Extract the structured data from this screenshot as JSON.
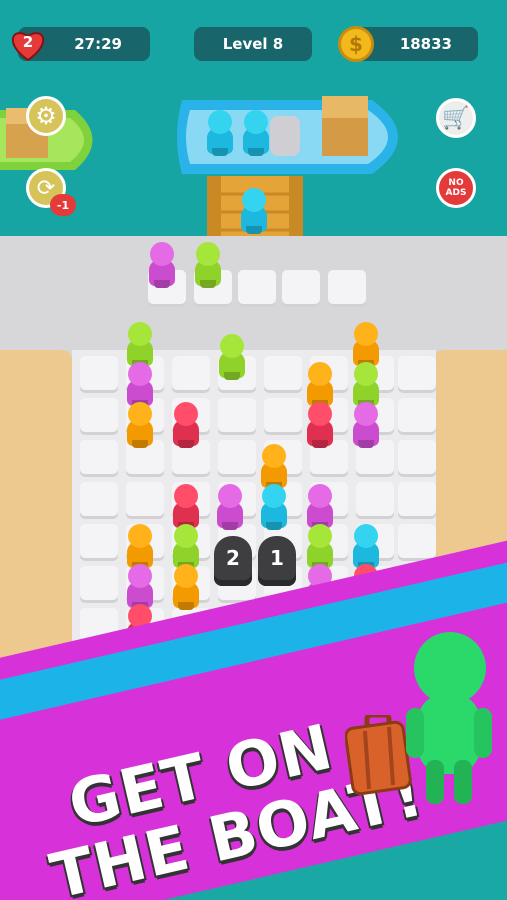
{
  "hud": {
    "lives": "2",
    "timer": "27:29",
    "level": "Level 8",
    "coins": "18833"
  },
  "buttons": {
    "no_ads_line1": "NO",
    "no_ads_line2": "ADS",
    "undo_badge": "-1"
  },
  "board": {
    "bollard_left": "2",
    "bollard_right": "1"
  },
  "promo": {
    "line1": "GET ON",
    "line2": "THE BOAT!"
  },
  "colors": {
    "water": "#17a5a3",
    "hud_panel": "#18656b",
    "boat_blue": "#2ab3e8",
    "boat_green": "#7fd23c",
    "heart_red": "#e53a3a",
    "coin_gold": "#f3b81b",
    "banner_pink": "#d732d9",
    "banner_blue": "#1cb4e8"
  },
  "characters": {
    "palette": [
      "lime",
      "magenta",
      "orange",
      "red",
      "cyan"
    ]
  }
}
